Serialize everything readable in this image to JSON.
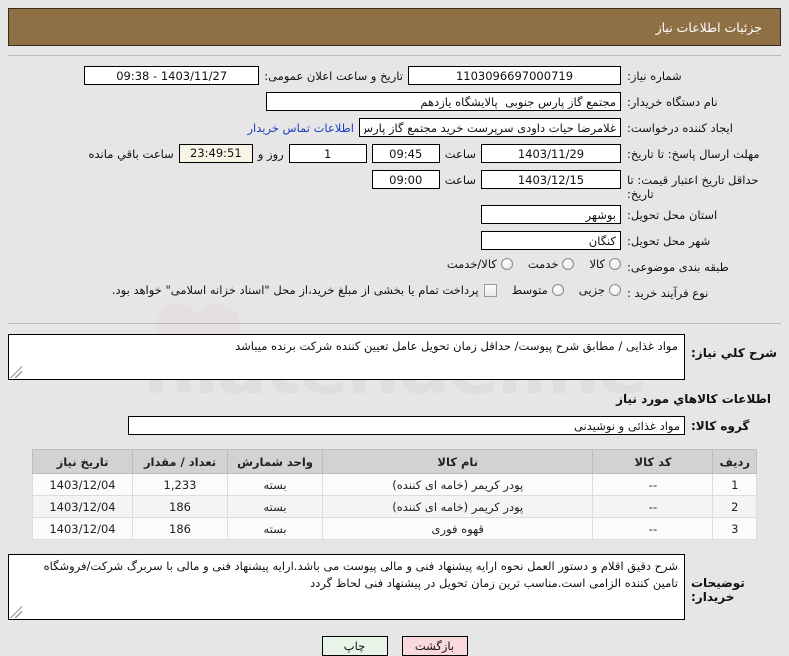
{
  "header": {
    "title": "جزئیات اطلاعات نیاز"
  },
  "watermark": {
    "text": "hiatender.ne"
  },
  "form": {
    "need_number_label": "شماره نیاز:",
    "need_number_value": "1103096697000719",
    "public_announce_label": "تاریخ و ساعت اعلان عمومی:",
    "public_announce_value": "1403/11/27 - 09:38",
    "buyer_org_label": "نام دستگاه خریدار:",
    "buyer_org_value": "مجتمع گاز پارس جنوبی  پالایشگاه یازدهم",
    "creator_label": "ایجاد کننده درخواست:",
    "creator_value": "غلامرضا حیات داودی سرپرست خرید مجتمع گاز پارس جنوبی  پالایشگاه یازدهم",
    "contact_link": "اطلاعات تماس خریدار",
    "reply_deadline_label": "مهلت ارسال پاسخ: تا تاریخ:",
    "reply_deadline_date": "1403/11/29",
    "reply_deadline_time_label": "ساعت",
    "reply_deadline_time": "09:45",
    "remaining_days": "1",
    "remaining_days_label": "روز و",
    "remaining_countdown": "23:49:51",
    "remaining_suffix_label": "ساعت باقي مانده",
    "price_validity_label": "حداقل تاریخ اعتبار قیمت: تا تاریخ:",
    "price_validity_date": "1403/12/15",
    "price_validity_time_label": "ساعت",
    "price_validity_time": "09:00",
    "province_label": "استان محل تحویل:",
    "province_value": "بوشهر",
    "city_label": "شهر محل تحویل:",
    "city_value": "کنگان",
    "category_label": "طبقه بندی موضوعی:",
    "category_options": [
      "کالا",
      "خدمت",
      "کالا/خدمت"
    ],
    "process_label": "نوع فرآیند خرید :",
    "process_options": [
      "جزیی",
      "متوسط"
    ],
    "treasury_note": "پرداخت تمام یا بخشی از مبلغ خرید،از محل \"اسناد خزانه اسلامی\" خواهد بود."
  },
  "description": {
    "label": "شرح كلي نياز:",
    "value": "مواد غذایی / مطابق شرح پیوست/ حداقل زمان تحویل عامل تعیین کننده شرکت برنده میباشد"
  },
  "goods_section": {
    "title": "اطلاعات كالاهاي مورد نياز",
    "group_label": "گروه کالا:",
    "group_value": "مواد غذائی و نوشیدنی"
  },
  "table": {
    "columns": [
      "ردیف",
      "کد کالا",
      "نام کالا",
      "واحد شمارش",
      "تعداد / مقدار",
      "تاریخ نیاز"
    ],
    "rows": [
      {
        "row": "1",
        "code": "--",
        "name": "پودر کریمر (خامه ای کننده)",
        "unit": "بسته",
        "qty": "1,233",
        "date": "1403/12/04"
      },
      {
        "row": "2",
        "code": "--",
        "name": "پودر کریمر (خامه ای کننده)",
        "unit": "بسته",
        "qty": "186",
        "date": "1403/12/04"
      },
      {
        "row": "3",
        "code": "--",
        "name": "قهوه فوری",
        "unit": "بسته",
        "qty": "186",
        "date": "1403/12/04"
      }
    ]
  },
  "notes": {
    "label": "توضیحات خریدار:",
    "value": "شرح دقیق اقلام و دستور العمل نحوه ارایه پیشنهاد فنی و مالی پیوست می باشد.ارایه پیشنهاد فنی و مالی با سربرگ شرکت/فروشگاه تامین کننده الزامی است.مناسب ترین زمان تحویل در پیشنهاد فنی لحاظ گردد"
  },
  "footer": {
    "print_label": "چاپ",
    "back_label": "بازگشت"
  },
  "colors": {
    "header_bg": "#8f7045",
    "link": "#1a3cc4",
    "countdown_bg": "#f6f5e6",
    "print_bg": "#e7f4e7",
    "back_bg": "#fad9dc",
    "table_header_bg": "#d2d2d2"
  }
}
